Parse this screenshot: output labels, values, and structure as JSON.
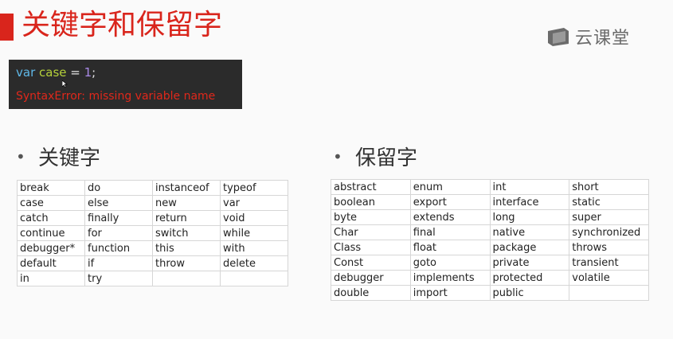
{
  "slide": {
    "title": "关键字和保留字",
    "accent_color": "#d9251c",
    "logo": {
      "text": "云课堂",
      "icon": "cloud-classroom-logo-icon"
    }
  },
  "code_box": {
    "line1": {
      "kw": "var",
      "ident": "case",
      "op": " = ",
      "num": "1",
      "end": ";"
    },
    "error": "SyntaxError: missing variable name"
  },
  "keywords": {
    "heading": "关键字",
    "rows": [
      [
        "break",
        "do",
        "instanceof",
        "typeof"
      ],
      [
        "case",
        "else",
        "new",
        "var"
      ],
      [
        "catch",
        "finally",
        "return",
        "void"
      ],
      [
        "continue",
        "for",
        "switch",
        "while"
      ],
      [
        "debugger*",
        "function",
        "this",
        "with"
      ],
      [
        "default",
        "if",
        "throw",
        "delete"
      ],
      [
        "in",
        "try",
        "",
        ""
      ]
    ]
  },
  "reserved": {
    "heading": "保留字",
    "rows": [
      [
        "abstract",
        "enum",
        "int",
        "short"
      ],
      [
        "boolean",
        "export",
        "interface",
        "static"
      ],
      [
        "byte",
        "extends",
        "long",
        "super"
      ],
      [
        "Char",
        "final",
        "native",
        "synchronized"
      ],
      [
        "Class",
        "float",
        "package",
        "throws"
      ],
      [
        "Const",
        "goto",
        "private",
        "transient"
      ],
      [
        "debugger",
        "implements",
        "protected",
        "volatile"
      ],
      [
        "double",
        "import",
        "public",
        ""
      ]
    ]
  }
}
